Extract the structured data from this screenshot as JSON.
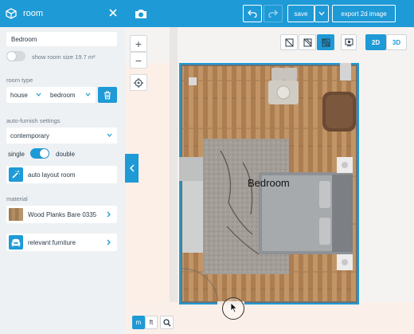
{
  "panel": {
    "title": "room",
    "room_name": "Bedroom",
    "show_room_size_label": "show room size 19.7 m²",
    "room_type_label": "room type",
    "room_type_category": "house",
    "room_type_value": "bedroom",
    "auto_furnish_label": "auto-furnish settings",
    "style_value": "contemporary",
    "single_label": "single",
    "double_label": "double",
    "auto_layout_label": "auto layout room",
    "material_label": "material",
    "material_value": "Wood Planks Bare 0335",
    "relevant_furniture_label": "relevant furniture"
  },
  "toolbar": {
    "save_label": "save",
    "export_label": "export 2d image"
  },
  "view": {
    "mode_2d": "2D",
    "mode_3d": "3D",
    "active_mode": "2D",
    "unit_m": "m",
    "unit_ft": "ft",
    "active_unit": "m"
  },
  "plan": {
    "room_label": "Bedroom"
  },
  "colors": {
    "accent": "#1e9ad6",
    "panel_bg": "#eef1f4",
    "wall": "#1e9ad6",
    "floor": "#b88a5b"
  }
}
